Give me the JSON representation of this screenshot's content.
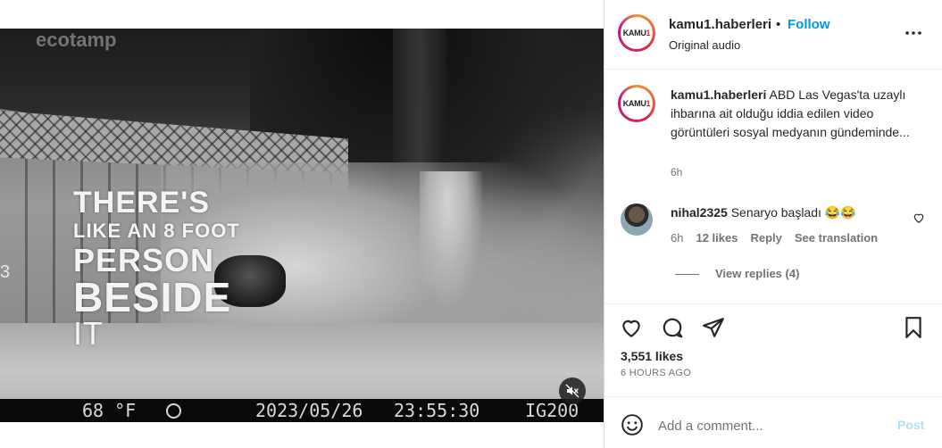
{
  "post": {
    "username": "kamu1.haberleri",
    "separator": "•",
    "follow_label": "Follow",
    "audio_label": "Original audio",
    "avatar_text_main": "KAMU",
    "avatar_text_accent": "1",
    "caption_text": "ABD Las Vegas'ta uzaylı ihbarına ait olduğu iddia edilen video görüntüleri sosyal medyanın gündeminde...",
    "caption_time": "6h",
    "likes": "3,551 likes",
    "time_ago": "6 HOURS AGO"
  },
  "video": {
    "overlay_lines": [
      "THERE'S",
      "LIKE AN 8 FOOT",
      "PERSON",
      "BESIDE",
      "IT"
    ],
    "left_number": "3",
    "watermark": "ecotamp",
    "temperature": "68 °F",
    "date": "2023/05/26",
    "time": "23:55:30",
    "camera_id": "IG200"
  },
  "comments": [
    {
      "username": "nihal2325",
      "text": "Senaryo başladı 😂😂",
      "time": "6h",
      "likes": "12 likes",
      "reply_label": "Reply",
      "translate_label": "See translation"
    }
  ],
  "view_replies_label": "View replies (4)",
  "add_comment": {
    "placeholder": "Add a comment...",
    "post_label": "Post"
  },
  "colors": {
    "link_blue": "#0095f6",
    "post_disabled": "#b2dffc",
    "muted_text": "#737373"
  },
  "icons": [
    "more-icon",
    "heart-icon",
    "comment-icon",
    "share-icon",
    "bookmark-icon",
    "emoji-icon",
    "mute-icon"
  ]
}
